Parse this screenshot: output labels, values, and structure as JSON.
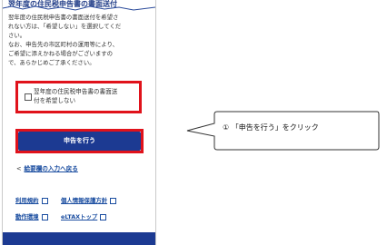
{
  "header": {
    "title": "翌年度の住民税申告書の書面送付"
  },
  "notice": {
    "line1": "翌年度の住民税申告書の書面送付を希望さ",
    "line2": "れない方は、「希望しない」を選択してくだ",
    "line3": "さい。",
    "line4": "なお、申告先の市区町村の運用等により、",
    "line5": "ご希望に添えかねる場合がございますの",
    "line6": "で、あらかじめご了承ください。"
  },
  "checkbox": {
    "label_line1": "翌年度の住民税申告書の書面送",
    "label_line2": "付を希望しない",
    "checked": false
  },
  "submit": {
    "label": "申告を行う"
  },
  "back": {
    "chevron": "<",
    "label": "給要欄の入力へ戻る"
  },
  "footer": {
    "terms": "利用規約",
    "privacy": "個人情報保護方針",
    "environment": "動作環境",
    "etax_top": "eLTAXトップ"
  },
  "callout": {
    "text": "① 「申告を行う」をクリック"
  },
  "colors": {
    "accent": "#e0121b",
    "primary": "#1c3a92",
    "link": "#1a4da0"
  }
}
